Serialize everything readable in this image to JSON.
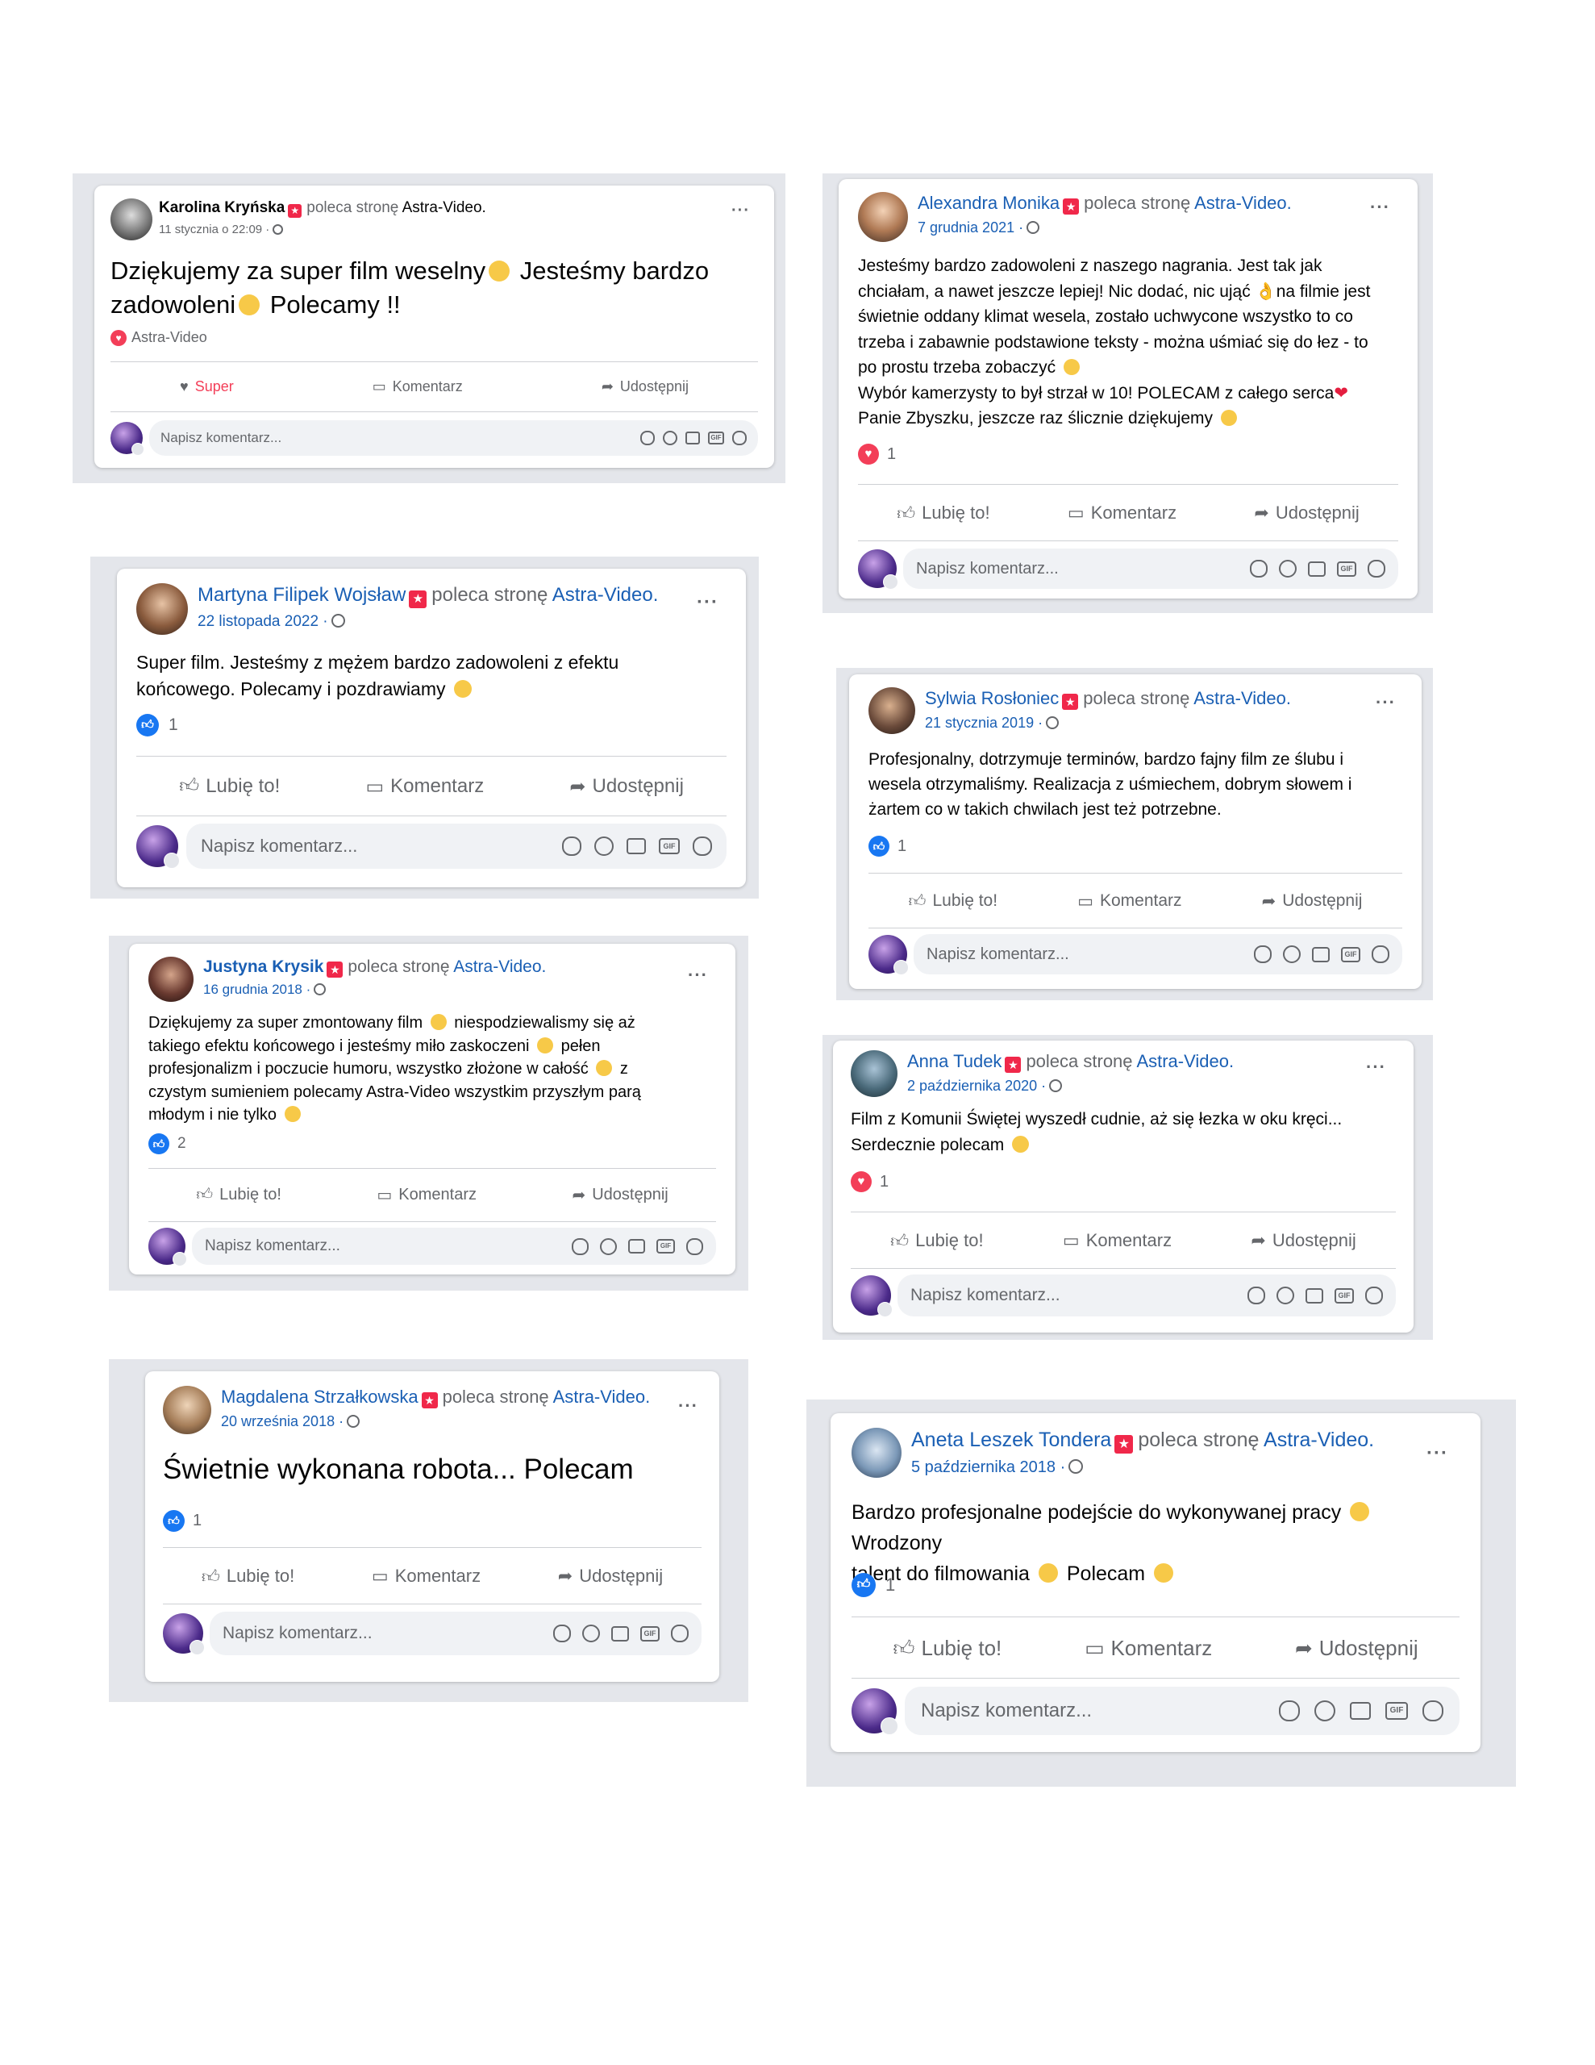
{
  "common": {
    "recommends": "poleca stronę",
    "page_name": "Astra-Video.",
    "like": "Lubię to!",
    "super": "Super",
    "comment": "Komentarz",
    "share": "Udostępnij",
    "write_comment": "Napisz komentarz...",
    "gif": "GIF"
  },
  "reviews": [
    {
      "name": "Karolina Kryńska",
      "date": "11 stycznia o 22:09 ·",
      "line1": "Dziękujemy za super film weselny",
      "line1b": " Jesteśmy bardzo",
      "line2": "zadowoleni",
      "line2b": " Polecamy !!",
      "reaction_label": "Astra-Video"
    },
    {
      "name": "Alexandra Monika",
      "date": "7 grudnia 2021 ·",
      "p1": "Jesteśmy bardzo zadowoleni z naszego nagrania. Jest tak jak",
      "p2": "chciałam, a nawet jeszcze lepiej! Nic dodać, nic ująć",
      "p2b": "na filmie jest",
      "p3": "świetnie oddany klimat wesela, zostało uchwycone wszystko to co",
      "p4": "trzeba i zabawnie podstawione teksty - można uśmiać się do łez - to",
      "p5": "po prostu trzeba zobaczyć",
      "p6": "Wybór kamerzysty to był strzał w 10! POLECAM z całego serca",
      "p7": "Panie Zbyszku, jeszcze raz ślicznie dziękujemy",
      "count": "1"
    },
    {
      "name": "Martyna Filipek Wojsław",
      "date": "22 listopada 2022 ·",
      "p1": "Super film. Jesteśmy z mężem bardzo  zadowoleni z efektu",
      "p2": "końcowego. Polecamy i pozdrawiamy",
      "count": "1"
    },
    {
      "name": "Sylwia Rosłoniec",
      "date": "21 stycznia 2019 ·",
      "p1": "Profesjonalny, dotrzymuje terminów, bardzo fajny film ze ślubu i",
      "p2": "wesela otrzymaliśmy. Realizacja z uśmiechem, dobrym słowem i",
      "p3": "żartem co w takich chwilach jest też potrzebne.",
      "count": "1"
    },
    {
      "name": "Justyna Krysik",
      "date": "16 grudnia 2018 ·",
      "p1": "Dziękujemy za super zmontowany film",
      "p1b": " niespodziewalismy się aż",
      "p2": "takiego efektu końcowego i jesteśmy miło zaskoczeni",
      "p2b": " pełen",
      "p3": "profesjonalizm i poczucie humoru, wszystko złożone w całość",
      "p3b": " z",
      "p4": "czystym sumieniem polecamy Astra-Video wszystkim przyszłym parą",
      "p5": "młodym i nie tylko",
      "count": "2"
    },
    {
      "name": "Anna Tudek",
      "date": "2 października 2020 ·",
      "p1": "Film z Komunii Świętej wyszedł cudnie, aż się łezka w oku kręci...",
      "p2": "Serdecznie polecam",
      "count": "1"
    },
    {
      "name": "Magdalena Strzałkowska",
      "date": "20 września 2018 ·",
      "p1": "Świetnie wykonana robota... Polecam",
      "count": "1"
    },
    {
      "name": "Aneta Leszek Tondera",
      "date": "5 października 2018 ·",
      "p1": "Bardzo profesjonalne podejście do wykonywanej pracy",
      "p1b": " Wrodzony",
      "p2": "talent do filmowania",
      "p2b": " Polecam",
      "count": "1"
    }
  ]
}
